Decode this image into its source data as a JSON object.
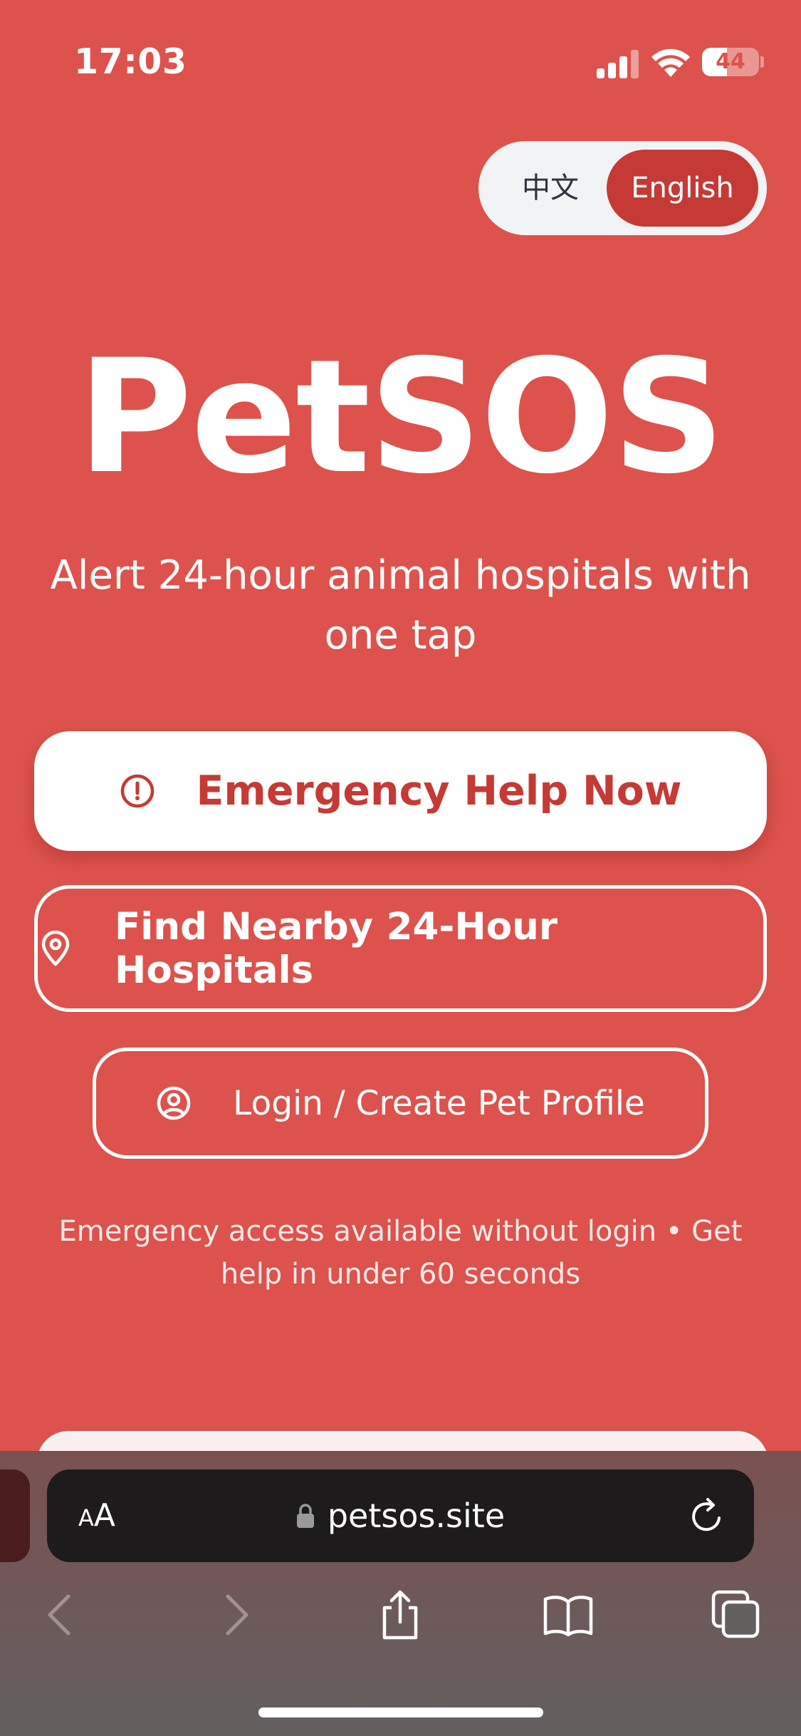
{
  "status_bar": {
    "time": "17:03",
    "battery_level": "44",
    "battery_fraction": 0.44,
    "signal_icon": "cellular-signal-icon",
    "wifi_icon": "wifi-icon"
  },
  "language_toggle": {
    "options": [
      "中文",
      "English"
    ],
    "selected": "English"
  },
  "hero": {
    "logo": "PetSOS",
    "tagline": "Alert 24-hour animal hospitals with one tap"
  },
  "actions": {
    "emergency": {
      "label": "Emergency Help Now",
      "icon": "alert-circle-icon"
    },
    "find_hospitals": {
      "label": "Find Nearby 24-Hour Hospitals",
      "icon": "map-pin-icon"
    },
    "login": {
      "label": "Login / Create Pet Profile",
      "icon": "user-circle-icon"
    }
  },
  "footnote": "Emergency access available without login • Get help in under 60 seconds",
  "browser": {
    "aa_small": "A",
    "aa_large": "A",
    "url": "petsos.site",
    "icons": [
      "lock-icon",
      "reload-icon",
      "back-icon",
      "forward-icon",
      "share-icon",
      "bookmarks-icon",
      "tabs-icon"
    ]
  },
  "colors": {
    "background": "#dd524c",
    "accent": "#c53a35",
    "white": "#ffffff",
    "browser_field": "#1d1b1b"
  }
}
